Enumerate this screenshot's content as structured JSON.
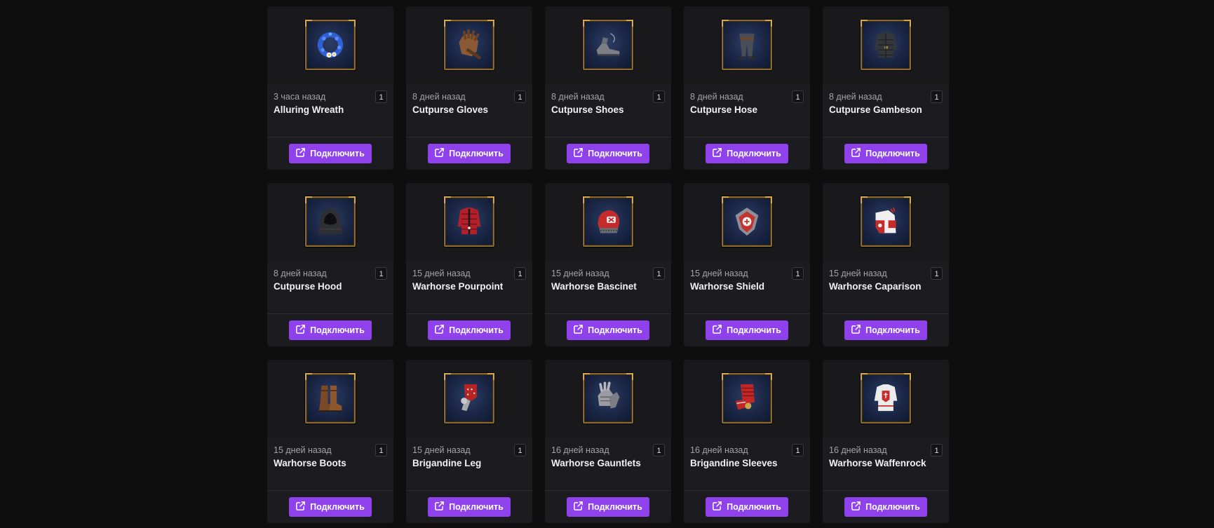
{
  "items": [
    {
      "time": "3 часа назад",
      "name": "Alluring Wreath",
      "count": "1",
      "button": "Подключить",
      "icon": "wreath"
    },
    {
      "time": "8 дней назад",
      "name": "Cutpurse Gloves",
      "count": "1",
      "button": "Подключить",
      "icon": "gloves"
    },
    {
      "time": "8 дней назад",
      "name": "Cutpurse Shoes",
      "count": "1",
      "button": "Подключить",
      "icon": "shoes"
    },
    {
      "time": "8 дней назад",
      "name": "Cutpurse Hose",
      "count": "1",
      "button": "Подключить",
      "icon": "hose"
    },
    {
      "time": "8 дней назад",
      "name": "Cutpurse Gambeson",
      "count": "1",
      "button": "Подключить",
      "icon": "gambeson"
    },
    {
      "time": "8 дней назад",
      "name": "Cutpurse Hood",
      "count": "1",
      "button": "Подключить",
      "icon": "hood"
    },
    {
      "time": "15 дней назад",
      "name": "Warhorse Pourpoint",
      "count": "1",
      "button": "Подключить",
      "icon": "pourpoint"
    },
    {
      "time": "15 дней назад",
      "name": "Warhorse Bascinet",
      "count": "1",
      "button": "Подключить",
      "icon": "bascinet"
    },
    {
      "time": "15 дней назад",
      "name": "Warhorse Shield",
      "count": "1",
      "button": "Подключить",
      "icon": "shield"
    },
    {
      "time": "15 дней назад",
      "name": "Warhorse Caparison",
      "count": "1",
      "button": "Подключить",
      "icon": "caparison"
    },
    {
      "time": "15 дней назад",
      "name": "Warhorse Boots",
      "count": "1",
      "button": "Подключить",
      "icon": "boots"
    },
    {
      "time": "15 дней назад",
      "name": "Brigandine Leg",
      "count": "1",
      "button": "Подключить",
      "icon": "leg"
    },
    {
      "time": "16 дней назад",
      "name": "Warhorse Gauntlets",
      "count": "1",
      "button": "Подключить",
      "icon": "gauntlets"
    },
    {
      "time": "16 дней назад",
      "name": "Brigandine Sleeves",
      "count": "1",
      "button": "Подключить",
      "icon": "sleeves"
    },
    {
      "time": "16 дней назад",
      "name": "Warhorse Waffenrock",
      "count": "1",
      "button": "Подключить",
      "icon": "waffenrock"
    }
  ],
  "colors": {
    "background": "#0e0e0f",
    "card": "#1c1c20",
    "accent": "#8f42ec",
    "frame_gold": "#8b6a2e"
  },
  "button_icon": "external-link-icon"
}
